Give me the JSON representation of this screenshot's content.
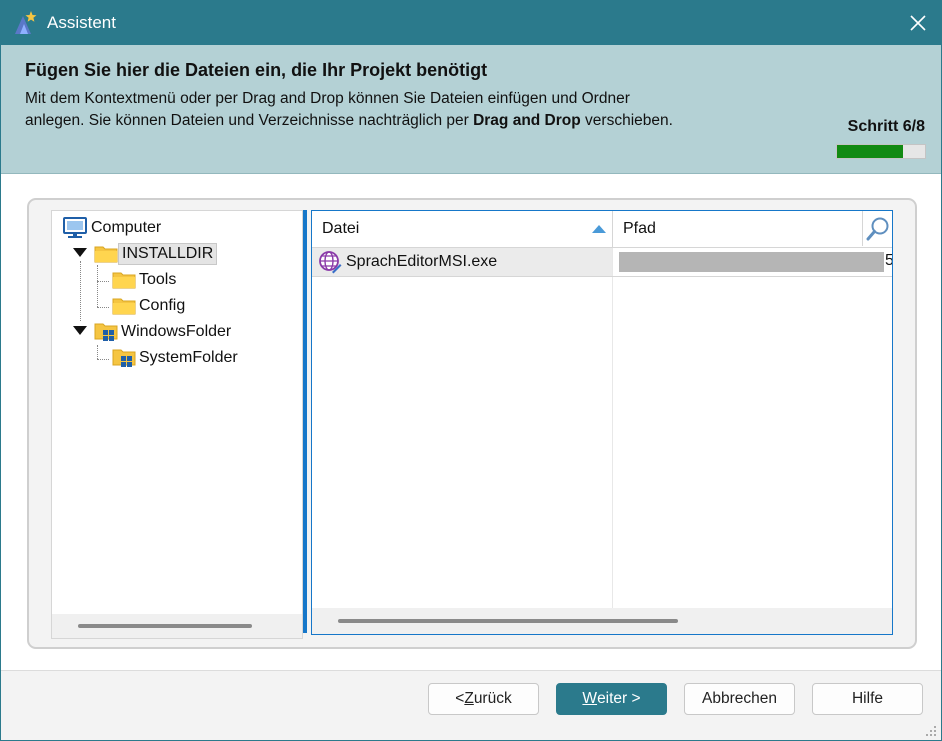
{
  "window": {
    "title": "Assistent"
  },
  "header": {
    "heading": "Fügen Sie hier die Dateien ein, die Ihr Projekt benötigt",
    "description_line1": "Mit dem Kontextmenü oder per Drag and Drop können Sie Dateien einfügen und Ordner",
    "description_line2_before": "anlegen. Sie können Dateien und Verzeichnisse nachträglich per ",
    "description_line2_bold": "Drag and Drop",
    "description_line2_after": " verschieben.",
    "step_label": "Schritt 6/8",
    "progress_fraction": 0.75,
    "progress_color": "#128a12"
  },
  "tree": {
    "nodes": [
      {
        "label": "Computer",
        "icon": "computer-icon"
      },
      {
        "label": "INSTALLDIR",
        "icon": "folder-icon",
        "expanded": true,
        "selected": true
      },
      {
        "label": "Tools",
        "icon": "folder-icon"
      },
      {
        "label": "Config",
        "icon": "folder-icon"
      },
      {
        "label": "WindowsFolder",
        "icon": "windows-folder-icon",
        "expanded": true
      },
      {
        "label": "SystemFolder",
        "icon": "windows-folder-icon"
      }
    ]
  },
  "file_list": {
    "columns": [
      "Datei",
      "Pfad"
    ],
    "sort_column": "Datei",
    "sort_direction": "ascending",
    "rows": [
      {
        "file": "SprachEditorMSI.exe",
        "icon": "globe-exe-icon",
        "path_visible_tail": "5"
      }
    ]
  },
  "buttons": {
    "back": {
      "prefix": "< ",
      "mnemonic": "Z",
      "rest": "urück"
    },
    "next": {
      "mnemonic": "W",
      "rest": "eiter >"
    },
    "cancel": "Abbrechen",
    "help": "Hilfe"
  },
  "colors": {
    "accent": "#2b7a8c",
    "header_bg": "#b4d1d5",
    "selection_border": "#1677c9"
  }
}
